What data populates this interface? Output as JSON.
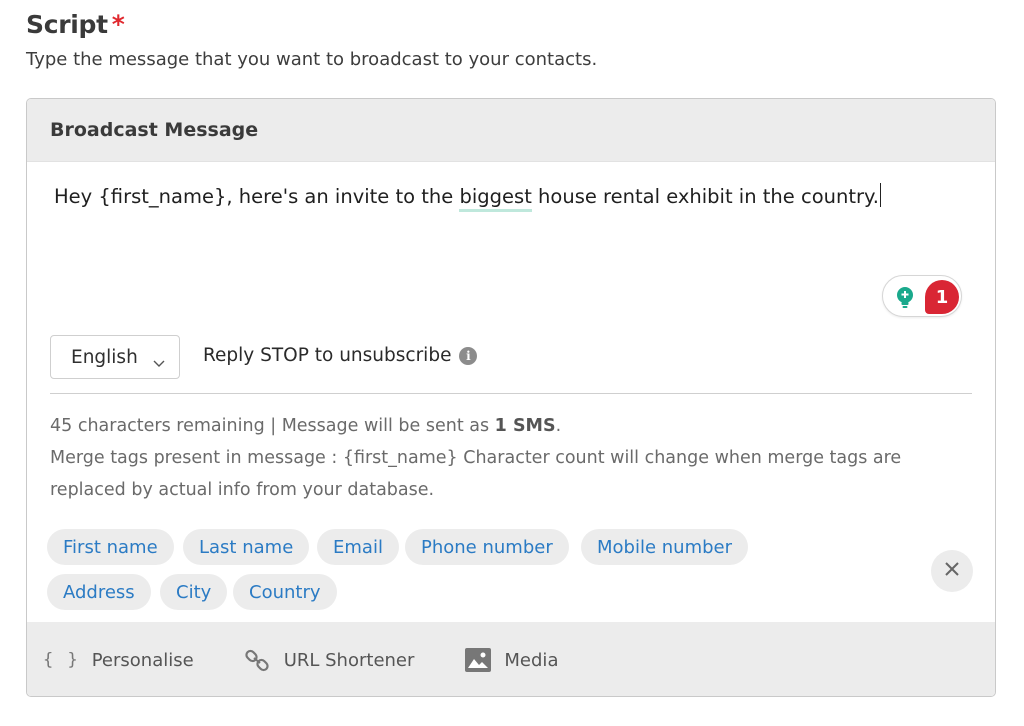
{
  "field": {
    "title": "Script",
    "required_mark": "*",
    "description": "Type the message that you want to broadcast to your contacts."
  },
  "panel": {
    "title": "Broadcast Message",
    "message": {
      "before": "Hey {first_name}, here's an invite to the ",
      "underlined": "biggest",
      "after": " house rental exhibit in the country."
    },
    "grammar_badge": {
      "icon": "lightbulb-icon",
      "count": "1"
    },
    "language": {
      "selected": "English"
    },
    "unsubscribe_text": "Reply STOP to unsubscribe",
    "info": {
      "remaining": "45 characters remaining | Message will be sent as ",
      "sms_count": "1 SMS",
      "sms_suffix": ".",
      "merge_line": "Merge tags present in message : {first_name} Character count will change when merge tags are replaced by actual info from your database."
    },
    "tags": [
      "First name",
      "Last name",
      "Email",
      "Phone number",
      "Mobile number",
      "Address",
      "City",
      "Country"
    ],
    "toolbar": {
      "personalise": {
        "icon": "braces-icon",
        "glyph": "{ }",
        "label": "Personalise"
      },
      "url_shortener": {
        "icon": "link-icon",
        "label": "URL Shortener"
      },
      "media": {
        "icon": "image-icon",
        "label": "Media"
      }
    },
    "colors": {
      "accent_link": "#2b7bc4",
      "required": "#e0282e",
      "badge_red": "#d92634",
      "bulb_teal": "#1aa98c",
      "underline": "#bfe8dc"
    }
  }
}
